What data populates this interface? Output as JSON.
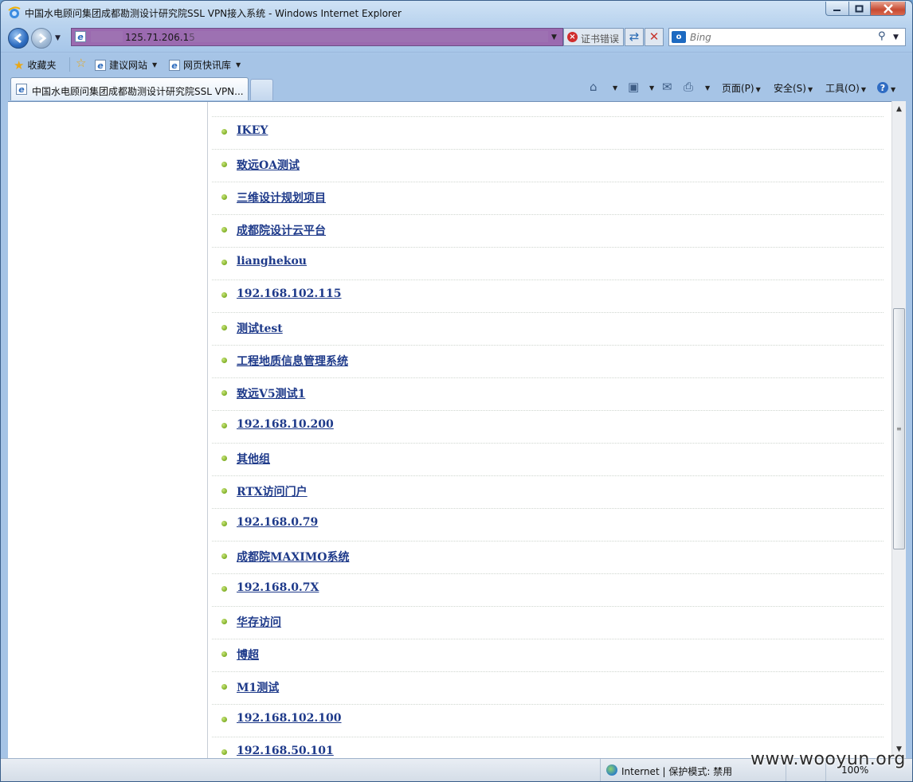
{
  "window": {
    "title": "中国水电顾问集团成都勘测设计研究院SSL VPN接入系统 - Windows Internet Explorer",
    "controls": {
      "minimize": "▁",
      "maximize": "□",
      "close": "✕"
    }
  },
  "navbar": {
    "address": "125.71.206.15",
    "cert_error": "证书错误",
    "search_placeholder": "Bing",
    "search_logo": "o"
  },
  "favorites_bar": {
    "favorites_label": "收藏夹",
    "suggested_sites": "建议网站",
    "web_slice_gallery": "网页快讯库"
  },
  "tabs": {
    "active_label": "中国水电顾问集团成都勘测设计研究院SSL VPN...",
    "page_menu": "页面(P)",
    "safety_menu": "安全(S)",
    "tools_menu": "工具(O)"
  },
  "resources": [
    "IKEY",
    "致远OA测试",
    "三维设计规划项目",
    "成都院设计云平台",
    "lianghekou",
    "192.168.102.115",
    "测试test",
    "工程地质信息管理系统",
    "致远V5测试1",
    "192.168.10.200",
    "其他组",
    "RTX访问门户",
    "192.168.0.79",
    "成都院MAXIMO系统",
    "192.168.0.7X",
    "华存访问",
    "博超",
    "M1测试",
    "192.168.102.100",
    "192.168.50.101"
  ],
  "statusbar": {
    "zone": "Internet | 保护模式: 禁用",
    "zoom": "100%"
  },
  "watermark": "www.wooyun.org"
}
